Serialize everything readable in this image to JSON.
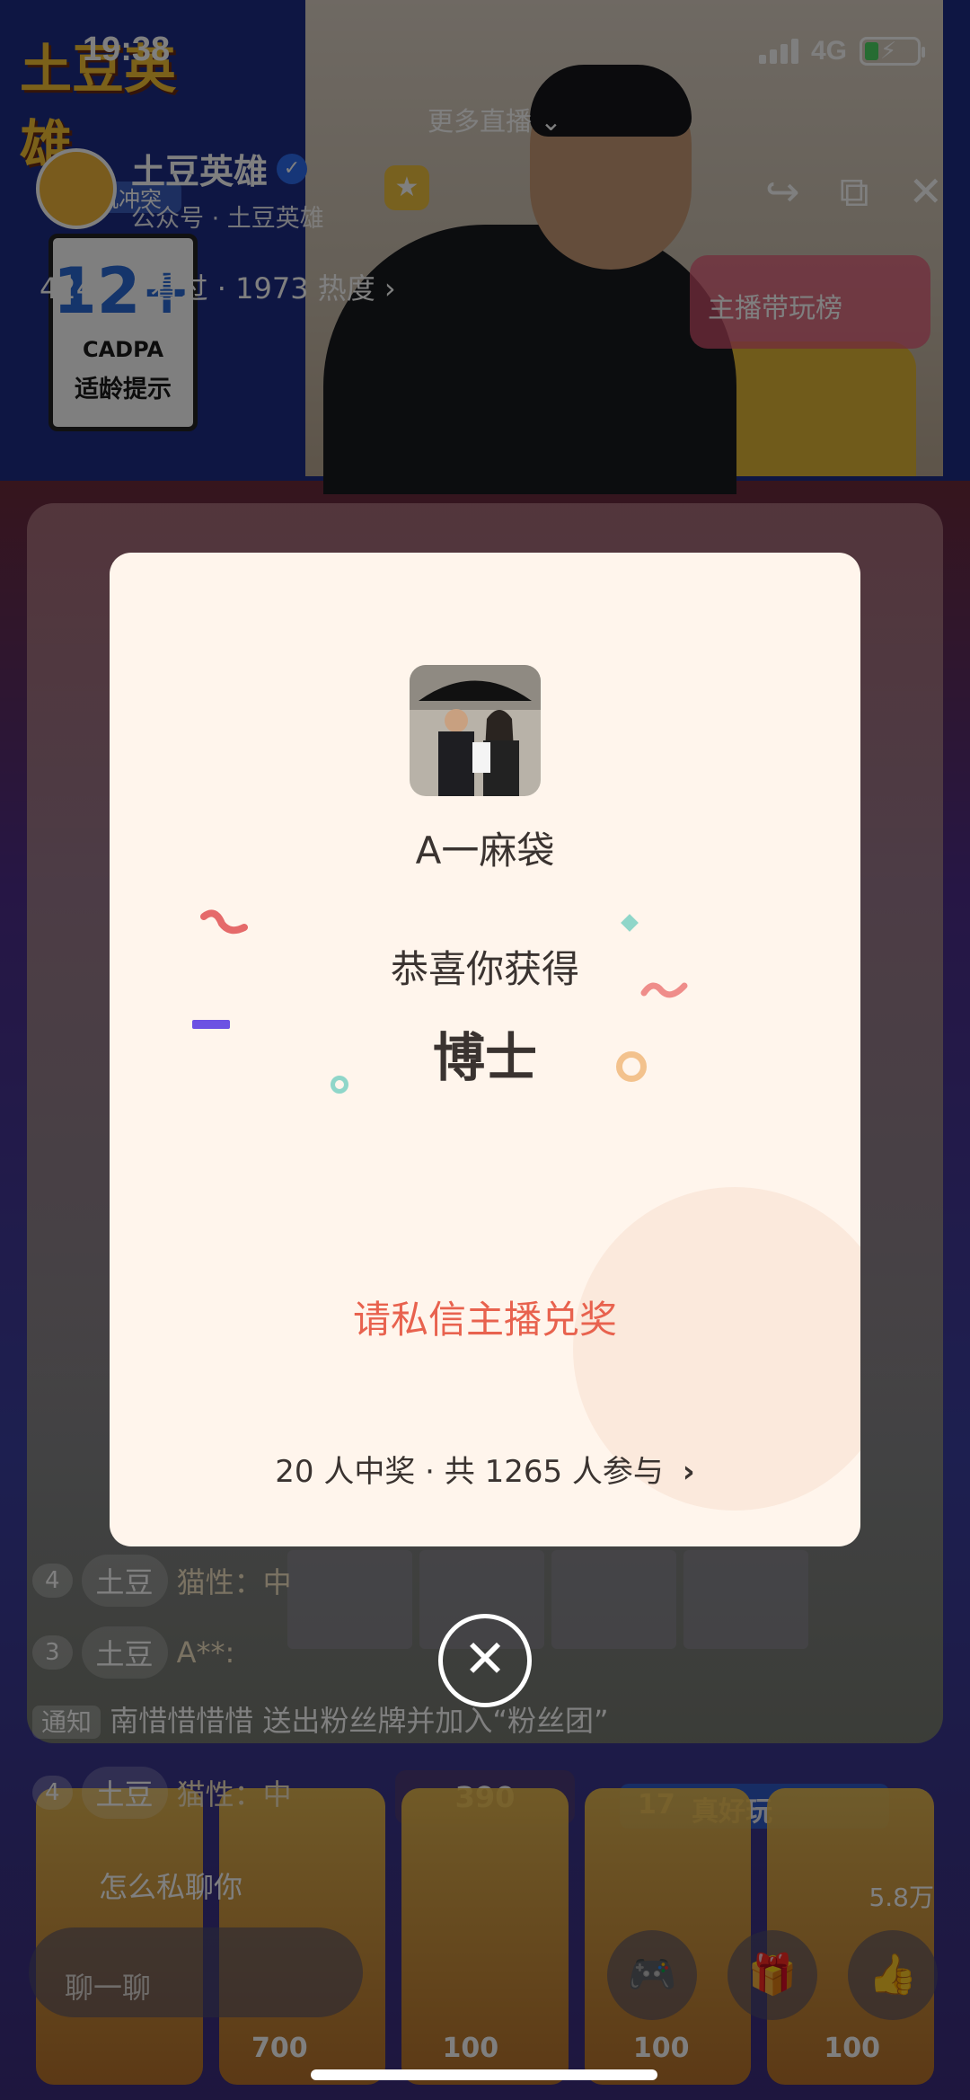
{
  "status_bar": {
    "time": "19:38",
    "network": "4G"
  },
  "header": {
    "more_live": "更多直播",
    "channel_name": "土豆英雄",
    "channel_sub": "公众号 · 土豆英雄",
    "viewers": "4243 人看过 · 1973 热度",
    "rank_pill": "主播带玩榜",
    "game_logo": "土豆英雄",
    "game_logo_sub": "随机冲突",
    "age_badge": {
      "age": "12+",
      "org": "CADPA",
      "tip": "适龄提示"
    }
  },
  "chat": {
    "rows": [
      {
        "level": "4",
        "badge": "土豆",
        "text": "猫性：中"
      },
      {
        "level": "3",
        "badge": "土豆",
        "text": "A**:"
      }
    ],
    "notice_tag": "通知",
    "notice_text": "南惜惜惜惜 送出粉丝牌并加入“粉丝团”",
    "last_row": {
      "level": "4",
      "badge": "土豆",
      "text": "猫性：中"
    },
    "last_message": "怎么私聊你",
    "input_placeholder": "聊一聊",
    "likes": "5.8万"
  },
  "game": {
    "level_badge": "17",
    "level_label": "真好玩",
    "coin_value": "390",
    "card_costs": [
      "700",
      "100",
      "100",
      "100"
    ]
  },
  "modal": {
    "winner_name": "A一麻袋",
    "congrats": "恭喜你获得",
    "prize": "博士",
    "redeem_hint": "请私信主播兑奖",
    "stats": "20 人中奖 · 共 1265 人参与"
  },
  "colors": {
    "modal_bg": "#fff5ec",
    "redeem_text": "#e8624e",
    "accent_blue": "#2c6cf0"
  }
}
